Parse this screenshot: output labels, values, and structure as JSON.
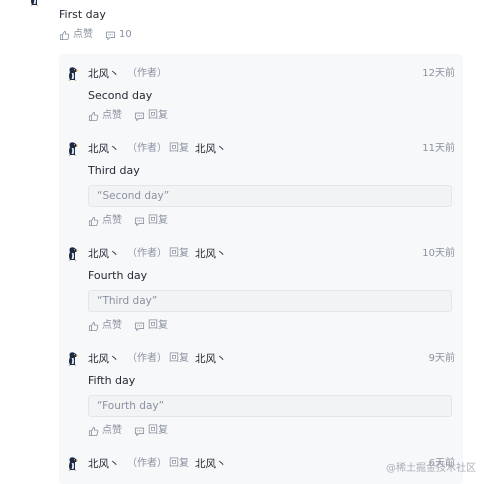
{
  "root_comment": {
    "text": "First day",
    "like_label": "点赞",
    "comment_count": "10"
  },
  "replies": [
    {
      "name": "北风丶",
      "role": "（作者）",
      "reply_label": "",
      "target": "",
      "time": "12天前",
      "content": "Second day",
      "quote": "",
      "like_label": "点赞",
      "reply_action": "回复"
    },
    {
      "name": "北风丶",
      "role": "（作者）",
      "reply_label": "回复",
      "target": "北风丶",
      "time": "11天前",
      "content": "Third day",
      "quote": "“Second day”",
      "like_label": "点赞",
      "reply_action": "回复"
    },
    {
      "name": "北风丶",
      "role": "（作者）",
      "reply_label": "回复",
      "target": "北风丶",
      "time": "10天前",
      "content": "Fourth day",
      "quote": "“Third day”",
      "like_label": "点赞",
      "reply_action": "回复"
    },
    {
      "name": "北风丶",
      "role": "（作者）",
      "reply_label": "回复",
      "target": "北风丶",
      "time": "9天前",
      "content": "Fifth day",
      "quote": "“Fourth day”",
      "like_label": "点赞",
      "reply_action": "回复"
    },
    {
      "name": "北风丶",
      "role": "（作者）",
      "reply_label": "回复",
      "target": "北风丶",
      "time": "6天前",
      "content": "",
      "quote": "",
      "like_label": "",
      "reply_action": ""
    }
  ],
  "watermark": "@稀土掘金技术社区",
  "colors": {
    "text": "#252933",
    "muted": "#8a919f",
    "panel": "#f7f8fa",
    "quote_bg": "#f2f3f5"
  },
  "icons": {
    "like": "thumbs-up-icon",
    "comment": "comment-bubble-icon",
    "avatar": "penguin-avatar"
  }
}
